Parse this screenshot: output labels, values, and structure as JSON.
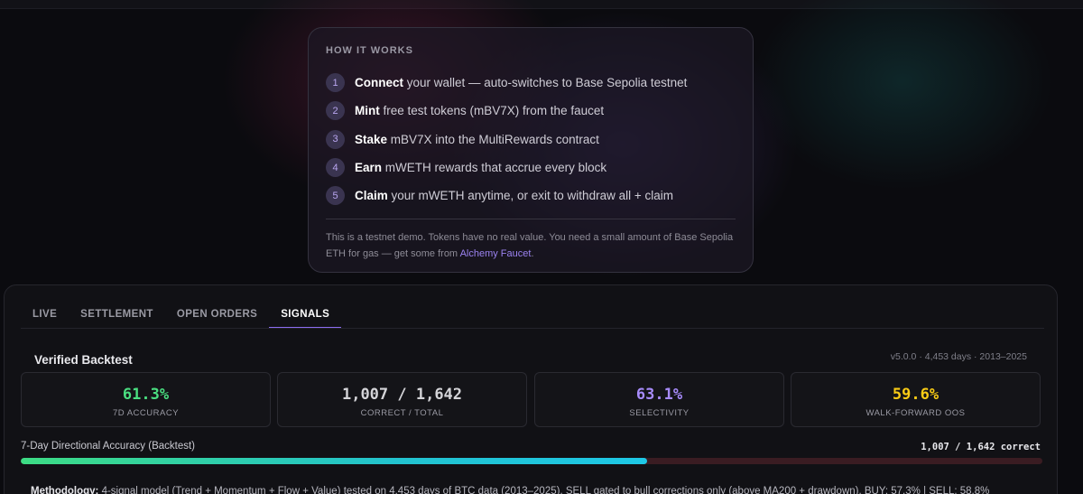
{
  "how_it_works": {
    "title": "HOW IT WORKS",
    "steps": [
      {
        "num": "1",
        "bold": "Connect",
        "rest": " your wallet — auto-switches to Base Sepolia testnet"
      },
      {
        "num": "2",
        "bold": "Mint",
        "rest": " free test tokens (mBV7X) from the faucet"
      },
      {
        "num": "3",
        "bold": "Stake",
        "rest": " mBV7X into the MultiRewards contract"
      },
      {
        "num": "4",
        "bold": "Earn",
        "rest": " mWETH rewards that accrue every block"
      },
      {
        "num": "5",
        "bold": "Claim",
        "rest": " your mWETH anytime, or exit to withdraw all + claim"
      }
    ],
    "note_text": "This is a testnet demo. Tokens have no real value. You need a small amount of Base Sepolia ETH for gas — get some from ",
    "note_link": "Alchemy Faucet",
    "note_end": "."
  },
  "tabs": [
    {
      "label": "LIVE",
      "active": false
    },
    {
      "label": "SETTLEMENT",
      "active": false
    },
    {
      "label": "OPEN ORDERS",
      "active": false
    },
    {
      "label": "SIGNALS",
      "active": true
    }
  ],
  "backtest": {
    "title": "Verified Backtest",
    "meta": "v5.0.0 · 4,453 days · 2013–2025",
    "stats": [
      {
        "value": "61.3%",
        "label": "7D ACCURACY",
        "color": "#4ade80"
      },
      {
        "value": "1,007 / 1,642",
        "label": "CORRECT / TOTAL",
        "color": "#d4d4d8"
      },
      {
        "value": "63.1%",
        "label": "SELECTIVITY",
        "color": "#a78bfa"
      },
      {
        "value": "59.6%",
        "label": "WALK-FORWARD OOS",
        "color": "#facc15"
      }
    ],
    "accuracy_label": "7-Day Directional Accuracy (Backtest)",
    "accuracy_right": "1,007 / 1,642 correct",
    "accuracy_fraction": 0.613,
    "methodology_label": "Methodology:",
    "methodology_text": " 4-signal model (Trend + Momentum + Flow + Value) tested on 4,453 days of BTC data (2013–2025). SELL gated to bull corrections only (above MA200 + drawdown). BUY: 57.3% | SELL: 58.8%"
  }
}
